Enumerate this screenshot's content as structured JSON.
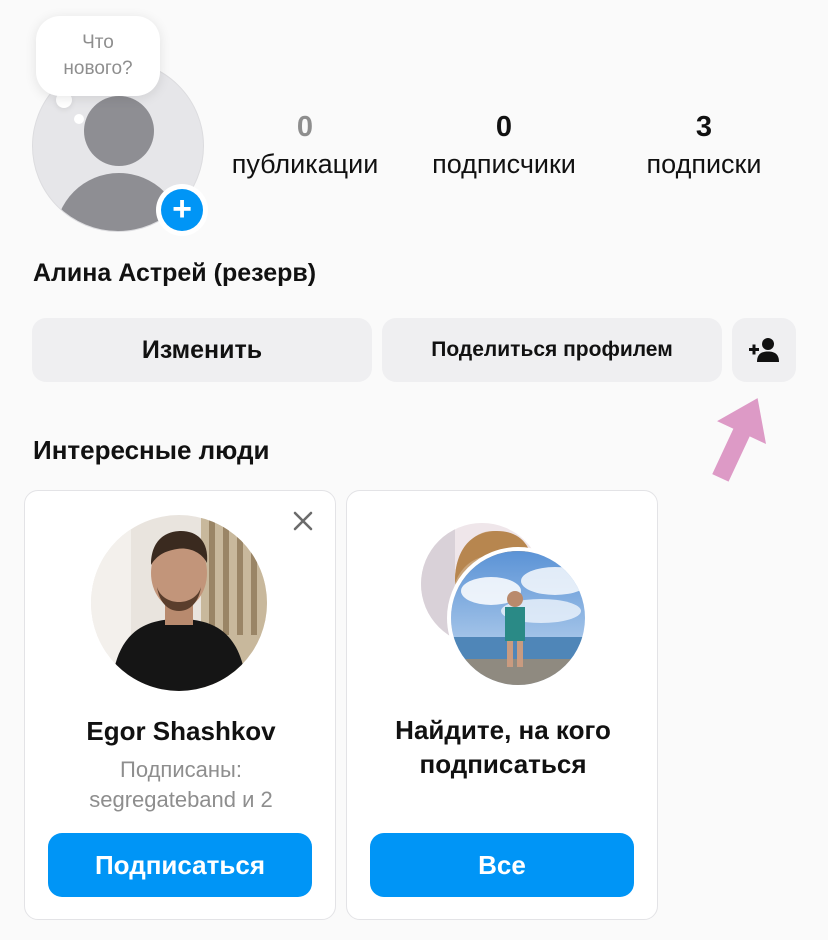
{
  "note": {
    "line1": "Что",
    "line2": "нового?"
  },
  "stats": {
    "posts": {
      "count": "0",
      "label": "публикации"
    },
    "followers": {
      "count": "0",
      "label": "подписчики"
    },
    "following": {
      "count": "3",
      "label": "подписки"
    }
  },
  "profile": {
    "name": "Алина Астрей (резерв)"
  },
  "actions": {
    "edit_label": "Изменить",
    "share_label": "Поделиться профилем",
    "add_user_icon": "person-plus-icon"
  },
  "suggestions": {
    "title": "Интересные люди",
    "cards": [
      {
        "name": "Egor Shashkov",
        "subtitle_line1": "Подписаны:",
        "subtitle_line2": "segregateband и 2",
        "button_label": "Подписаться"
      },
      {
        "title_line1": "Найдите, на кого",
        "title_line2": "подписаться",
        "button_label": "Все"
      }
    ]
  },
  "colors": {
    "accent": "#0095f6",
    "button_grey": "#efeff1",
    "muted_text": "#8e8e8e",
    "annotation_arrow": "#dd9ac6"
  }
}
